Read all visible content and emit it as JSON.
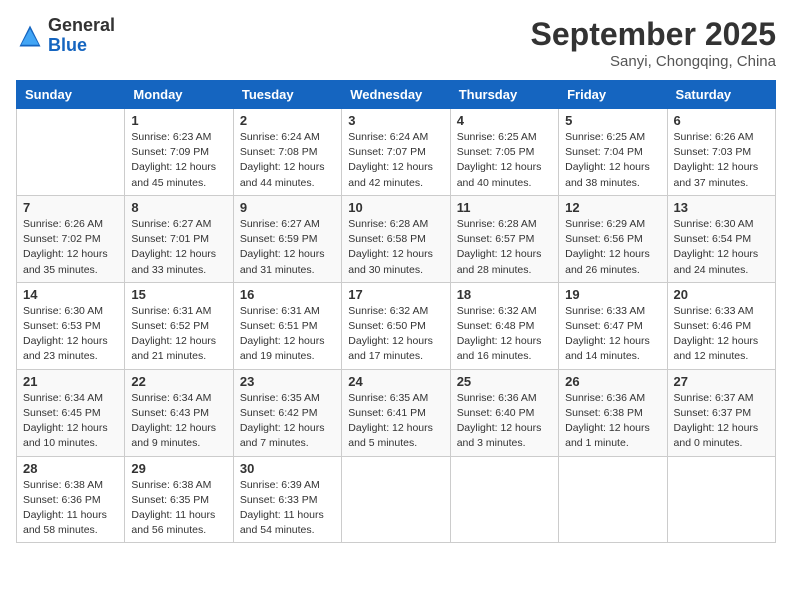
{
  "logo": {
    "general": "General",
    "blue": "Blue"
  },
  "header": {
    "month": "September 2025",
    "location": "Sanyi, Chongqing, China"
  },
  "weekdays": [
    "Sunday",
    "Monday",
    "Tuesday",
    "Wednesday",
    "Thursday",
    "Friday",
    "Saturday"
  ],
  "weeks": [
    [
      {
        "day": "",
        "info": ""
      },
      {
        "day": "1",
        "info": "Sunrise: 6:23 AM\nSunset: 7:09 PM\nDaylight: 12 hours\nand 45 minutes."
      },
      {
        "day": "2",
        "info": "Sunrise: 6:24 AM\nSunset: 7:08 PM\nDaylight: 12 hours\nand 44 minutes."
      },
      {
        "day": "3",
        "info": "Sunrise: 6:24 AM\nSunset: 7:07 PM\nDaylight: 12 hours\nand 42 minutes."
      },
      {
        "day": "4",
        "info": "Sunrise: 6:25 AM\nSunset: 7:05 PM\nDaylight: 12 hours\nand 40 minutes."
      },
      {
        "day": "5",
        "info": "Sunrise: 6:25 AM\nSunset: 7:04 PM\nDaylight: 12 hours\nand 38 minutes."
      },
      {
        "day": "6",
        "info": "Sunrise: 6:26 AM\nSunset: 7:03 PM\nDaylight: 12 hours\nand 37 minutes."
      }
    ],
    [
      {
        "day": "7",
        "info": "Sunrise: 6:26 AM\nSunset: 7:02 PM\nDaylight: 12 hours\nand 35 minutes."
      },
      {
        "day": "8",
        "info": "Sunrise: 6:27 AM\nSunset: 7:01 PM\nDaylight: 12 hours\nand 33 minutes."
      },
      {
        "day": "9",
        "info": "Sunrise: 6:27 AM\nSunset: 6:59 PM\nDaylight: 12 hours\nand 31 minutes."
      },
      {
        "day": "10",
        "info": "Sunrise: 6:28 AM\nSunset: 6:58 PM\nDaylight: 12 hours\nand 30 minutes."
      },
      {
        "day": "11",
        "info": "Sunrise: 6:28 AM\nSunset: 6:57 PM\nDaylight: 12 hours\nand 28 minutes."
      },
      {
        "day": "12",
        "info": "Sunrise: 6:29 AM\nSunset: 6:56 PM\nDaylight: 12 hours\nand 26 minutes."
      },
      {
        "day": "13",
        "info": "Sunrise: 6:30 AM\nSunset: 6:54 PM\nDaylight: 12 hours\nand 24 minutes."
      }
    ],
    [
      {
        "day": "14",
        "info": "Sunrise: 6:30 AM\nSunset: 6:53 PM\nDaylight: 12 hours\nand 23 minutes."
      },
      {
        "day": "15",
        "info": "Sunrise: 6:31 AM\nSunset: 6:52 PM\nDaylight: 12 hours\nand 21 minutes."
      },
      {
        "day": "16",
        "info": "Sunrise: 6:31 AM\nSunset: 6:51 PM\nDaylight: 12 hours\nand 19 minutes."
      },
      {
        "day": "17",
        "info": "Sunrise: 6:32 AM\nSunset: 6:50 PM\nDaylight: 12 hours\nand 17 minutes."
      },
      {
        "day": "18",
        "info": "Sunrise: 6:32 AM\nSunset: 6:48 PM\nDaylight: 12 hours\nand 16 minutes."
      },
      {
        "day": "19",
        "info": "Sunrise: 6:33 AM\nSunset: 6:47 PM\nDaylight: 12 hours\nand 14 minutes."
      },
      {
        "day": "20",
        "info": "Sunrise: 6:33 AM\nSunset: 6:46 PM\nDaylight: 12 hours\nand 12 minutes."
      }
    ],
    [
      {
        "day": "21",
        "info": "Sunrise: 6:34 AM\nSunset: 6:45 PM\nDaylight: 12 hours\nand 10 minutes."
      },
      {
        "day": "22",
        "info": "Sunrise: 6:34 AM\nSunset: 6:43 PM\nDaylight: 12 hours\nand 9 minutes."
      },
      {
        "day": "23",
        "info": "Sunrise: 6:35 AM\nSunset: 6:42 PM\nDaylight: 12 hours\nand 7 minutes."
      },
      {
        "day": "24",
        "info": "Sunrise: 6:35 AM\nSunset: 6:41 PM\nDaylight: 12 hours\nand 5 minutes."
      },
      {
        "day": "25",
        "info": "Sunrise: 6:36 AM\nSunset: 6:40 PM\nDaylight: 12 hours\nand 3 minutes."
      },
      {
        "day": "26",
        "info": "Sunrise: 6:36 AM\nSunset: 6:38 PM\nDaylight: 12 hours\nand 1 minute."
      },
      {
        "day": "27",
        "info": "Sunrise: 6:37 AM\nSunset: 6:37 PM\nDaylight: 12 hours\nand 0 minutes."
      }
    ],
    [
      {
        "day": "28",
        "info": "Sunrise: 6:38 AM\nSunset: 6:36 PM\nDaylight: 11 hours\nand 58 minutes."
      },
      {
        "day": "29",
        "info": "Sunrise: 6:38 AM\nSunset: 6:35 PM\nDaylight: 11 hours\nand 56 minutes."
      },
      {
        "day": "30",
        "info": "Sunrise: 6:39 AM\nSunset: 6:33 PM\nDaylight: 11 hours\nand 54 minutes."
      },
      {
        "day": "",
        "info": ""
      },
      {
        "day": "",
        "info": ""
      },
      {
        "day": "",
        "info": ""
      },
      {
        "day": "",
        "info": ""
      }
    ]
  ]
}
